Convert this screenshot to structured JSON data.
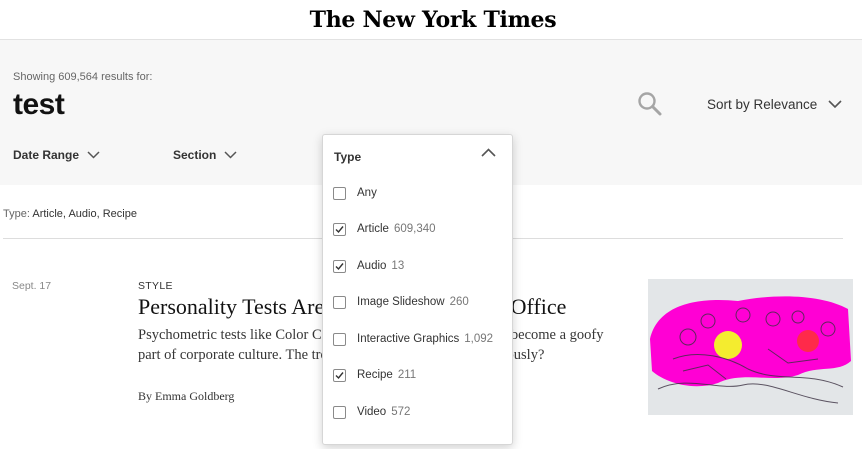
{
  "masthead": {
    "logo": "The New York Times"
  },
  "search": {
    "showing_text": "Showing 609,564 results for:",
    "query": "test",
    "sort_label": "Sort by Relevance",
    "filters": {
      "date_range": "Date Range",
      "section": "Section",
      "type": "Type"
    }
  },
  "type_menu": {
    "header": "Type",
    "options": [
      {
        "label": "Any",
        "count": "",
        "checked": false
      },
      {
        "label": "Article",
        "count": "609,340",
        "checked": true
      },
      {
        "label": "Audio",
        "count": "13",
        "checked": true
      },
      {
        "label": "Image Slideshow",
        "count": "260",
        "checked": false
      },
      {
        "label": "Interactive Graphics",
        "count": "1,092",
        "checked": false
      },
      {
        "label": "Recipe",
        "count": "211",
        "checked": true
      },
      {
        "label": "Video",
        "count": "572",
        "checked": false
      }
    ]
  },
  "applied_filters": {
    "label": "Type:",
    "values": [
      "Article,",
      "Audio,",
      "Recipe"
    ]
  },
  "result": {
    "date": "Sept. 17",
    "section": "STYLE",
    "title": "Personality Tests Are the Astrology of the Office",
    "summary": "Psychometric tests like Color Code, Enneagram and DiSC have become a goofy part of corporate culture. The trouble is when we take them seriously?",
    "byline": "By Emma Goldberg"
  },
  "icons": {
    "search": "search-icon",
    "chevron_down": "chevron-down-icon",
    "chevron_up": "chevron-up-icon",
    "check": "check-icon"
  },
  "colors": {
    "panel_bg": "#f7f7f7",
    "text": "#121212",
    "muted": "#777777"
  }
}
